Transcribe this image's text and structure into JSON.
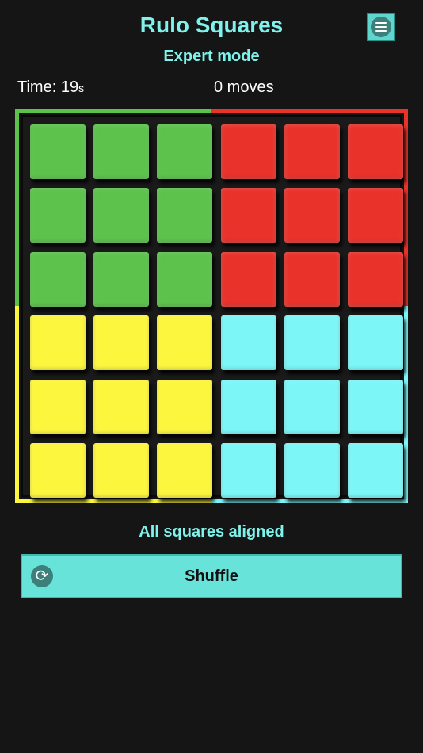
{
  "header": {
    "title": "Rulo Squares",
    "subtitle": "Expert mode",
    "menu_icon": "hamburger-menu-icon"
  },
  "stats": {
    "time_label": "Time: 19",
    "time_unit": "s",
    "moves": "0 moves"
  },
  "board": {
    "rows": 6,
    "cols": 6,
    "colors": {
      "green": "#5cc24c",
      "red": "#e8322a",
      "yellow": "#fcf63e",
      "cyan": "#7df6f7"
    },
    "tiles": [
      [
        "green",
        "green",
        "green",
        "red",
        "red",
        "red"
      ],
      [
        "green",
        "green",
        "green",
        "red",
        "red",
        "red"
      ],
      [
        "green",
        "green",
        "green",
        "red",
        "red",
        "red"
      ],
      [
        "yellow",
        "yellow",
        "yellow",
        "cyan",
        "cyan",
        "cyan"
      ],
      [
        "yellow",
        "yellow",
        "yellow",
        "cyan",
        "cyan",
        "cyan"
      ],
      [
        "yellow",
        "yellow",
        "yellow",
        "cyan",
        "cyan",
        "cyan"
      ]
    ],
    "quadrant_colors": {
      "top_left": "#5cc24c",
      "top_right": "#e8322a",
      "bottom_left": "#fcf63e",
      "bottom_right": "#7df6f7"
    }
  },
  "status": "All squares aligned",
  "shuffle": {
    "label": "Shuffle",
    "icon": "refresh-icon"
  }
}
